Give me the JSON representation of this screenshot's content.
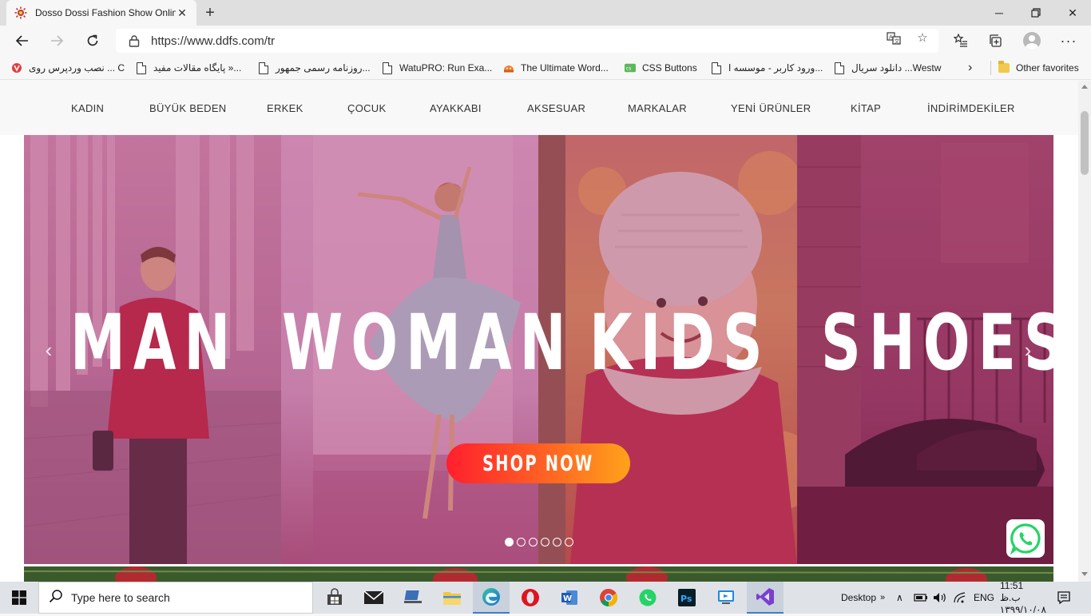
{
  "browser": {
    "tab_title": "Dosso Dossi Fashion Show Online",
    "url": "https://www.ddfs.com/tr",
    "favorites": [
      "نصب وردپرس روی ... C",
      "پایگاه مقالات مفید »...",
      "روزنامه رسمی جمهور...",
      "WatuPRO: Run Exa...",
      "The Ultimate Word...",
      "CSS Buttons",
      "ورود کاربر - موسسه ا...",
      "دانلود سریال ...Westw"
    ],
    "other_favorites": "Other favorites"
  },
  "site": {
    "nav": [
      "KADIN",
      "BÜYÜK BEDEN",
      "ERKEK",
      "ÇOCUK",
      "AYAKKABI",
      "AKSESUAR",
      "MARKALAR",
      "YENİ ÜRÜNLER",
      "KİTAP",
      "İNDİRİMDEKİLER"
    ],
    "hero": {
      "words": [
        "MAN",
        "WOMAN",
        "KIDS",
        "SHOES"
      ],
      "cta": "SHOP NOW",
      "slide_count": 6,
      "active_slide": 1
    }
  },
  "taskbar": {
    "search_placeholder": "Type here to search",
    "desktop_label": "Desktop",
    "lang": "ENG",
    "time": "11:51 ب.ظ",
    "date": "۱۳۹۹/۱۰/۰۸"
  },
  "colors": {
    "overlay": "#b4326e",
    "cta_start": "#ff1f2e",
    "cta_end": "#ffa21a",
    "whatsapp": "#25d366"
  }
}
